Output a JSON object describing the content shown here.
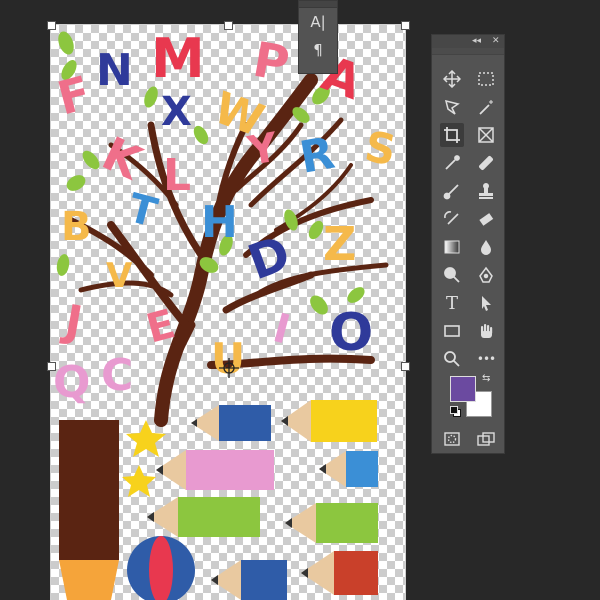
{
  "character_panel": {
    "text_tool_glyph": "A|",
    "paragraph_glyph": "¶"
  },
  "tools_panel": {
    "collapse_glyph": "◂◂",
    "close_glyph": "✕",
    "tools": [
      {
        "name": "move-tool-icon"
      },
      {
        "name": "marquee-tool-icon"
      },
      {
        "name": "lasso-tool-icon"
      },
      {
        "name": "magic-wand-tool-icon"
      },
      {
        "name": "crop-tool-icon"
      },
      {
        "name": "frame-tool-icon"
      },
      {
        "name": "eyedropper-tool-icon"
      },
      {
        "name": "healing-brush-tool-icon"
      },
      {
        "name": "brush-tool-icon"
      },
      {
        "name": "clone-stamp-tool-icon"
      },
      {
        "name": "history-brush-tool-icon"
      },
      {
        "name": "eraser-tool-icon"
      },
      {
        "name": "gradient-tool-icon"
      },
      {
        "name": "blur-tool-icon"
      },
      {
        "name": "dodge-tool-icon"
      },
      {
        "name": "pen-tool-icon"
      },
      {
        "name": "type-tool-icon"
      },
      {
        "name": "path-selection-tool-icon"
      },
      {
        "name": "rectangle-tool-icon"
      },
      {
        "name": "hand-tool-icon"
      },
      {
        "name": "zoom-tool-icon"
      },
      {
        "name": "more-tools-icon"
      }
    ],
    "type_glyph": "T",
    "more_glyph": "•••",
    "foreground_color": "#6b4aa0",
    "background_color": "#ffffff"
  },
  "artwork": {
    "letters": [
      {
        "ch": "F",
        "color": "#ef6f8a"
      },
      {
        "ch": "N",
        "color": "#2f3a9a"
      },
      {
        "ch": "M",
        "color": "#e8384f"
      },
      {
        "ch": "P",
        "color": "#ef6f8a"
      },
      {
        "ch": "A",
        "color": "#e8384f"
      },
      {
        "ch": "X",
        "color": "#2f3a9a"
      },
      {
        "ch": "W",
        "color": "#f5b94a"
      },
      {
        "ch": "K",
        "color": "#ef6f8a"
      },
      {
        "ch": "L",
        "color": "#ef6f8a"
      },
      {
        "ch": "T",
        "color": "#3b8fd6"
      },
      {
        "ch": "Y",
        "color": "#ef6f8a"
      },
      {
        "ch": "R",
        "color": "#3b8fd6"
      },
      {
        "ch": "S",
        "color": "#f5b94a"
      },
      {
        "ch": "B",
        "color": "#f5b94a"
      },
      {
        "ch": "V",
        "color": "#f5b94a"
      },
      {
        "ch": "H",
        "color": "#3b8fd6"
      },
      {
        "ch": "D",
        "color": "#2f3a9a"
      },
      {
        "ch": "Z",
        "color": "#f5b94a"
      },
      {
        "ch": "J",
        "color": "#ef6f8a"
      },
      {
        "ch": "E",
        "color": "#ef6f8a"
      },
      {
        "ch": "U",
        "color": "#f5b94a"
      },
      {
        "ch": "I",
        "color": "#e89ad0"
      },
      {
        "ch": "O",
        "color": "#2f3a9a"
      },
      {
        "ch": "Q",
        "color": "#e89ad0"
      },
      {
        "ch": "C",
        "color": "#e89ad0"
      }
    ]
  }
}
